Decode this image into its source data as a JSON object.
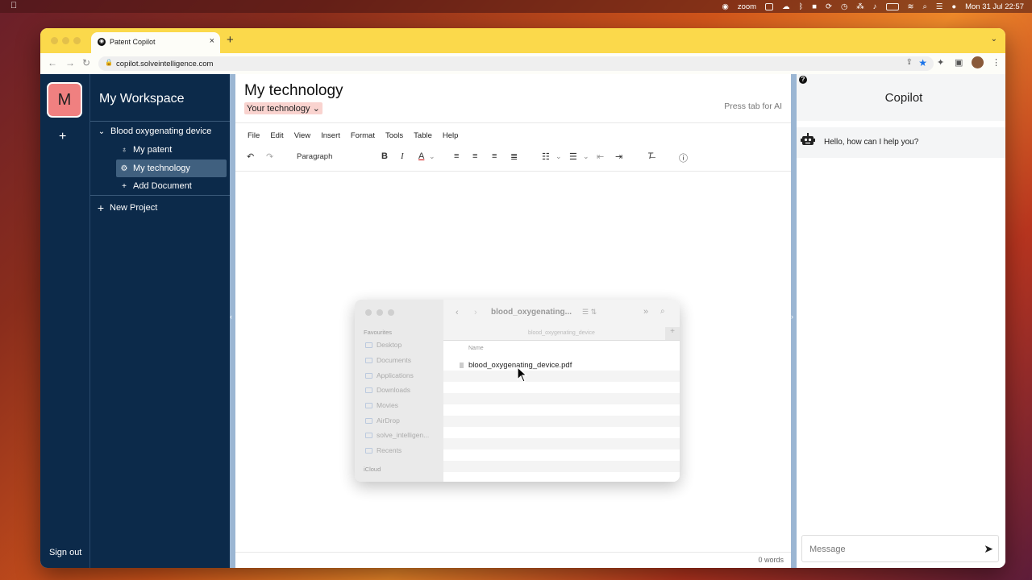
{
  "menubar": {
    "app_label": "zoom",
    "datetime": "Mon 31 Jul  22:57"
  },
  "browser": {
    "tab_title": "Patent Copilot",
    "tab_close": "×",
    "new_tab": "+",
    "url": "copilot.solveintelligence.com"
  },
  "rail": {
    "avatar_letter": "M",
    "add": "+",
    "sign_out": "Sign out"
  },
  "sidebar": {
    "title": "My Workspace",
    "project": "Blood oxygenating device",
    "items": [
      {
        "label": "My patent",
        "icon": "bulb-icon"
      },
      {
        "label": "My technology",
        "icon": "gear-icon"
      },
      {
        "label": "Add Document",
        "icon": "plus-icon"
      }
    ],
    "new_project": "New Project"
  },
  "editor": {
    "title": "My technology",
    "doc_type": "Your technology",
    "hint": "Press tab for AI",
    "menus": [
      "File",
      "Edit",
      "View",
      "Insert",
      "Format",
      "Tools",
      "Table",
      "Help"
    ],
    "paragraph": "Paragraph",
    "word_count": "0 words"
  },
  "copilot": {
    "title": "Copilot",
    "greeting": "Hello, how can I help you?",
    "placeholder": "Message"
  },
  "finder": {
    "title": "blood_oxygenating...",
    "path": "blood_oxygenating_device",
    "section_favourites": "Favourites",
    "favourites": [
      "Desktop",
      "Documents",
      "Applications",
      "Downloads",
      "Movies",
      "AirDrop",
      "solve_intelligen...",
      "Recents"
    ],
    "section_icloud": "iCloud",
    "column_name": "Name",
    "file": "blood_oxygenating_device.pdf"
  },
  "colors": {
    "sidebar_bg": "#0c2a4a",
    "tabbar": "#fbd94b",
    "avatar_bg": "#f08080",
    "doc_select_bg": "#f9d3cf",
    "divider": "#9bb6d3"
  }
}
